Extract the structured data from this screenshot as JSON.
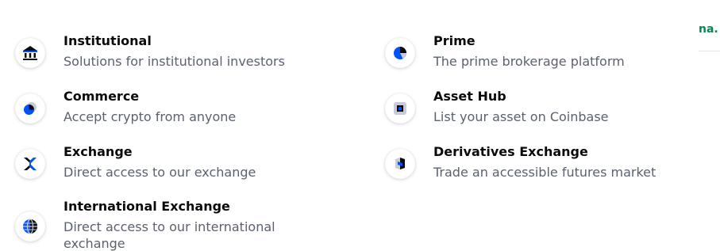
{
  "menu": {
    "left": [
      {
        "title": "Institutional",
        "desc": "Solutions for institutional investors",
        "icon": "bank-icon"
      },
      {
        "title": "Commerce",
        "desc": "Accept crypto from anyone",
        "icon": "commerce-icon"
      },
      {
        "title": "Exchange",
        "desc": "Direct access to our exchange",
        "icon": "exchange-icon"
      },
      {
        "title": "International Exchange",
        "desc": "Direct access to our international exchange",
        "icon": "globe-icon"
      }
    ],
    "right": [
      {
        "title": "Prime",
        "desc": "The prime brokerage platform",
        "icon": "pie-chart-icon"
      },
      {
        "title": "Asset Hub",
        "desc": "List your asset on Coinbase",
        "icon": "asset-hub-icon"
      },
      {
        "title": "Derivatives Exchange",
        "desc": "Trade an accessible futures market",
        "icon": "derivatives-icon"
      }
    ]
  },
  "corner": {
    "text": "na."
  },
  "colors": {
    "blue": "#0052ff",
    "navy": "#0a0b0d",
    "gray": "#5b616e",
    "green": "#098551"
  }
}
